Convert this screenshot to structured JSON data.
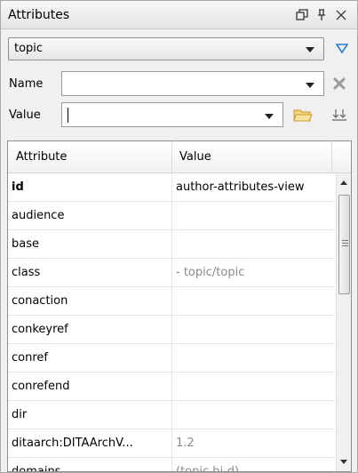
{
  "panel": {
    "title": "Attributes",
    "icons": [
      "maximize-icon",
      "pin-icon",
      "close-icon"
    ]
  },
  "element_select": {
    "value": "topic"
  },
  "name_field": {
    "label": "Name",
    "value": ""
  },
  "value_field": {
    "label": "Value",
    "value": ""
  },
  "table": {
    "headers": {
      "attribute": "Attribute",
      "value": "Value"
    },
    "rows": [
      {
        "name": "id",
        "value": "author-attributes-view",
        "bold": true,
        "default": false
      },
      {
        "name": "audience",
        "value": ""
      },
      {
        "name": "base",
        "value": ""
      },
      {
        "name": "class",
        "value": "- topic/topic",
        "default": true
      },
      {
        "name": "conaction",
        "value": ""
      },
      {
        "name": "conkeyref",
        "value": ""
      },
      {
        "name": "conref",
        "value": ""
      },
      {
        "name": "conrefend",
        "value": ""
      },
      {
        "name": "dir",
        "value": ""
      },
      {
        "name": "ditaarch:DITAArchV...",
        "value": "1.2",
        "default": true
      },
      {
        "name": "domains",
        "value": "(topic hi-d)",
        "default": true
      }
    ]
  },
  "colors": {
    "filter_icon": "#2a7fd4",
    "folder_icon": "#e8b84a",
    "remove_icon": "#9a9a9a"
  }
}
